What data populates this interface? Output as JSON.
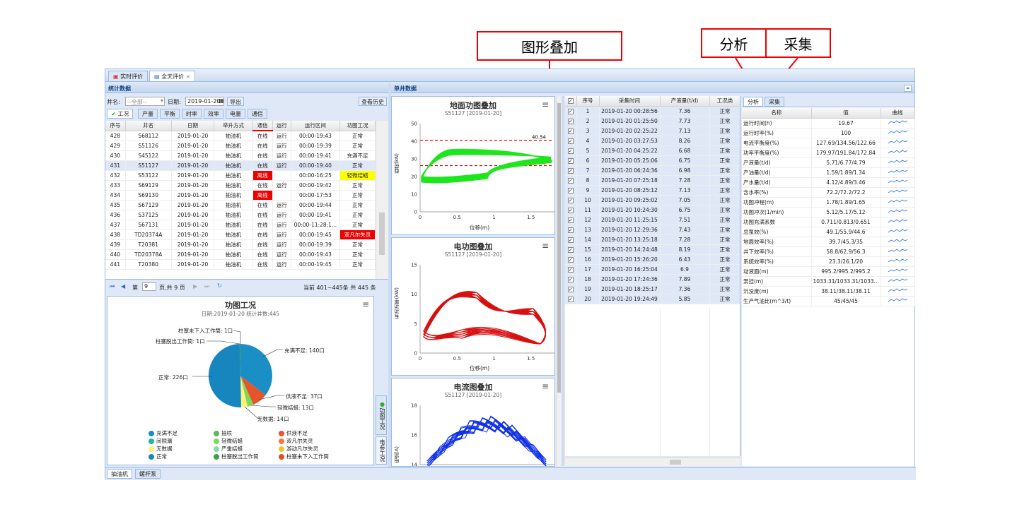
{
  "callouts": {
    "overlay": "图形叠加",
    "analysis": "分析",
    "collect": "采集"
  },
  "tabs": [
    {
      "label": "实时评价"
    },
    {
      "label": "全天评价"
    }
  ],
  "left_header": "统计数据",
  "right_header": "单井数据",
  "filter": {
    "well_label": "井名:",
    "well_value": "--全部--",
    "date_label": "日期:",
    "date_value": "2019-01-20",
    "export": "导出",
    "history": "查看历史"
  },
  "subtabs": [
    "工况",
    "产量",
    "平衡",
    "时率",
    "效率",
    "电量",
    "通信"
  ],
  "stats_table": {
    "headers": [
      "序号",
      "井名",
      "日期",
      "举升方式",
      "通信",
      "运行",
      "运行区间",
      "功图工况"
    ],
    "rows": [
      [
        "428",
        "S68112",
        "2019-01-20",
        "抽油机",
        "在线",
        "运行",
        "00:00-19:43",
        "正常"
      ],
      [
        "429",
        "S51126",
        "2019-01-20",
        "抽油机",
        "在线",
        "运行",
        "00:00-19:39",
        "正常"
      ],
      [
        "430",
        "S45122",
        "2019-01-20",
        "抽油机",
        "在线",
        "运行",
        "00:00-19:41",
        "充满不足"
      ],
      [
        "431",
        "S51127",
        "2019-01-20",
        "抽油机",
        "在线",
        "运行",
        "00:00-19:40",
        "正常"
      ],
      [
        "432",
        "S53122",
        "2019-01-20",
        "抽油机",
        "离线",
        "",
        "00:00-16:25",
        "轻微结蜡"
      ],
      [
        "433",
        "S69129",
        "2019-01-20",
        "抽油机",
        "在线",
        "运行",
        "00:00-19:42",
        "正常"
      ],
      [
        "434",
        "S69130",
        "2019-01-20",
        "抽油机",
        "离线",
        "",
        "00:00-17:53",
        "正常"
      ],
      [
        "435",
        "S67129",
        "2019-01-20",
        "抽油机",
        "在线",
        "运行",
        "00:00-19:44",
        "正常"
      ],
      [
        "436",
        "S37125",
        "2019-01-20",
        "抽油机",
        "在线",
        "运行",
        "00:00-19:41",
        "正常"
      ],
      [
        "437",
        "S67131",
        "2019-01-20",
        "抽油机",
        "在线",
        "运行",
        "00:00-11:28;1...",
        "正常"
      ],
      [
        "438",
        "TD20374A",
        "2019-01-20",
        "抽油机",
        "在线",
        "运行",
        "00:00-19:45",
        "双凡尔失灵"
      ],
      [
        "439",
        "T20381",
        "2019-01-20",
        "抽油机",
        "在线",
        "运行",
        "00:00-19:39",
        "正常"
      ],
      [
        "440",
        "TD20378A",
        "2019-01-20",
        "抽油机",
        "在线",
        "运行",
        "00:00-19:43",
        "正常"
      ],
      [
        "441",
        "T20380",
        "2019-01-20",
        "抽油机",
        "在线",
        "运行",
        "00:00-19:45",
        "正常"
      ]
    ]
  },
  "pager": {
    "page_label": "第",
    "page": "9",
    "total": "页,共 9 页",
    "info": "当前 401~445条 共 445 条"
  },
  "pie": {
    "title": "功图工况",
    "subtitle": "日期:2019-01-20 统计井数:445",
    "labels": [
      {
        "text": "柱塞未下入工作筒: 1口"
      },
      {
        "text": "柱塞脱出工作筒: 1口"
      },
      {
        "text": "充满不足: 140口"
      },
      {
        "text": "正常: 226口"
      },
      {
        "text": "供液不足: 37口"
      },
      {
        "text": "轻微结蜡: 13口"
      },
      {
        "text": "无数据: 14口"
      }
    ],
    "legend": [
      {
        "name": "充满不足",
        "color": "#1a8fc6"
      },
      {
        "name": "抽喷",
        "color": "#5cb85c"
      },
      {
        "name": "供液不足",
        "color": "#e8542a"
      },
      {
        "name": "间隙漏",
        "color": "#20b5a5"
      },
      {
        "name": "轻微结蜡",
        "color": "#7ed957"
      },
      {
        "name": "双凡尔失灵",
        "color": "#f07b3f"
      },
      {
        "name": "无数据",
        "color": "#fff27a"
      },
      {
        "name": "严重结蜡",
        "color": "#7fe0a8"
      },
      {
        "name": "游动凡尔失灵",
        "color": "#f2c230"
      },
      {
        "name": "正常",
        "color": "#1786bf"
      },
      {
        "name": "柱塞脱出工作筒",
        "color": "#3fa046"
      },
      {
        "name": "柱塞未下入工作筒",
        "color": "#e04f20"
      }
    ]
  },
  "vtabs": [
    "功图工况",
    "电参工况"
  ],
  "bottom_tabs": [
    "抽油机",
    "螺杆泵"
  ],
  "chart1": {
    "title": "地面功图叠加",
    "subtitle": "S51127 [2019-01-20]",
    "ylabel": "载荷(kN)",
    "xlabel": "位移(m)",
    "line_hi": "40.54",
    "line_lo": "26.18",
    "yticks": [
      "50",
      "40",
      "30",
      "20",
      "10",
      "0"
    ],
    "xticks": [
      "0",
      "0.5",
      "1",
      "1.5"
    ]
  },
  "chart2": {
    "title": "电功图叠加",
    "subtitle": "S51127 [2019-01-20]",
    "ylabel": "有功功率(kW)",
    "xlabel": "位移(m)",
    "yticks": [
      "15",
      "10",
      "5",
      "0"
    ],
    "xticks": [
      "0",
      "0.5",
      "1",
      "1.5"
    ]
  },
  "chart3": {
    "title": "电流图叠加",
    "subtitle": "S51127 [2019-01-20]",
    "ylabel": "电流(A)",
    "yticks": [
      "18",
      "16",
      "14"
    ]
  },
  "data_table": {
    "headers": [
      "序号",
      "采集时间",
      "产液量(t/d)",
      "工况类"
    ],
    "rows": [
      [
        "1",
        "2019-01-20 00:28:56",
        "7.36",
        "正常"
      ],
      [
        "2",
        "2019-01-20 01:25:50",
        "7.73",
        "正常"
      ],
      [
        "3",
        "2019-01-20 02:25:22",
        "7.13",
        "正常"
      ],
      [
        "4",
        "2019-01-20 03:27:53",
        "8.26",
        "正常"
      ],
      [
        "5",
        "2019-01-20 04:25:22",
        "6.68",
        "正常"
      ],
      [
        "6",
        "2019-01-20 05:25:06",
        "6.75",
        "正常"
      ],
      [
        "7",
        "2019-01-20 06:24:36",
        "6.98",
        "正常"
      ],
      [
        "8",
        "2019-01-20 07:25:18",
        "7.28",
        "正常"
      ],
      [
        "9",
        "2019-01-20 08:25:12",
        "7.13",
        "正常"
      ],
      [
        "10",
        "2019-01-20 09:25:02",
        "7.05",
        "正常"
      ],
      [
        "11",
        "2019-01-20 10:24:30",
        "6.75",
        "正常"
      ],
      [
        "12",
        "2019-01-20 11:25:15",
        "7.51",
        "正常"
      ],
      [
        "13",
        "2019-01-20 12:29:36",
        "7.43",
        "正常"
      ],
      [
        "14",
        "2019-01-20 13:25:18",
        "7.28",
        "正常"
      ],
      [
        "15",
        "2019-01-20 14:24:48",
        "8.19",
        "正常"
      ],
      [
        "16",
        "2019-01-20 15:26:20",
        "6.43",
        "正常"
      ],
      [
        "17",
        "2019-01-20 16:25:04",
        "6.9",
        "正常"
      ],
      [
        "18",
        "2019-01-20 17:24:36",
        "7.89",
        "正常"
      ],
      [
        "19",
        "2019-01-20 18:25:17",
        "7.36",
        "正常"
      ],
      [
        "20",
        "2019-01-20 19:24:49",
        "5.85",
        "正常"
      ]
    ]
  },
  "analysis_tabs": [
    "分析",
    "采集"
  ],
  "analysis_table": {
    "headers": [
      "名称",
      "值",
      "曲线"
    ],
    "rows": [
      [
        "运行时间(h)",
        "19.67"
      ],
      [
        "运行时率(%)",
        "100"
      ],
      [
        "电流平衡度(%)",
        "127.69/134.56/122.66"
      ],
      [
        "功率平衡度(%)",
        "179.97/191.84/172.84"
      ],
      [
        "产液量(t/d)",
        "5.71/6.77/4.79"
      ],
      [
        "产油量(t/d)",
        "1.59/1.89/1.34"
      ],
      [
        "产水量(t/d)",
        "4.12/4.89/3.46"
      ],
      [
        "含水率(%)",
        "72.2/72.2/72.2"
      ],
      [
        "功图冲程(m)",
        "1.78/1.89/1.65"
      ],
      [
        "功图冲次(1/min)",
        "5.12/5.17/5.12"
      ],
      [
        "功图充满系数",
        "0.711/0.813/0.651"
      ],
      [
        "总泵效(%)",
        "49.1/55.9/44.6"
      ],
      [
        "地面效率(%)",
        "39.7/45.3/35"
      ],
      [
        "井下效率(%)",
        "58.8/62.9/56.3"
      ],
      [
        "系统效率(%)",
        "23.3/26.1/20"
      ],
      [
        "动液面(m)",
        "995.2/995.2/995.2"
      ],
      [
        "泵挂(m)",
        "1033.31/1033.31/1033..."
      ],
      [
        "沉没度(m)",
        "38.11/38.11/38.11"
      ],
      [
        "生产气油比(m^3/t)",
        "45/45/45"
      ]
    ]
  }
}
